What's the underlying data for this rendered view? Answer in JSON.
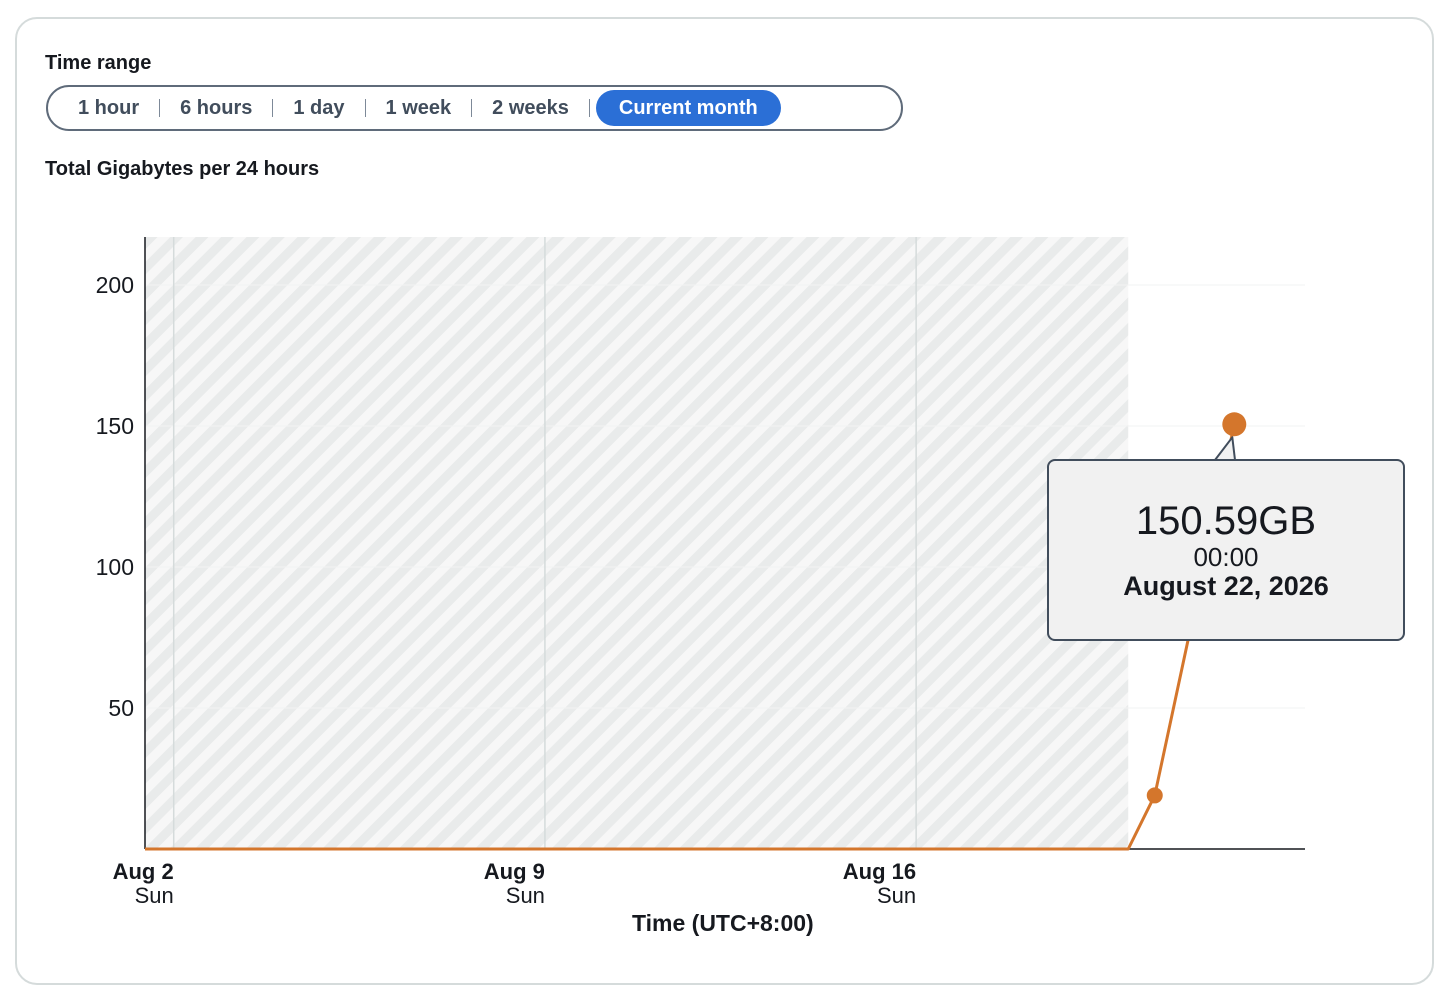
{
  "time_range": {
    "label": "Time range",
    "options": [
      "1 hour",
      "6 hours",
      "1 day",
      "1 week",
      "2 weeks",
      "Current month"
    ],
    "selected": "Current month"
  },
  "chart_title": "Total Gigabytes per 24 hours",
  "tooltip": {
    "value": "150.59GB",
    "time": "00:00",
    "date": "August 22, 2026"
  },
  "colors": {
    "series": "#d4762c",
    "selected_segment": "#2b6fd6",
    "hatch": "#e9ebeb"
  },
  "chart_data": {
    "type": "line",
    "title": "Total Gigabytes per 24 hours",
    "xlabel": "Time (UTC+8:00)",
    "ylabel": "",
    "ylim": [
      0,
      217
    ],
    "yticks": [
      50,
      100,
      150,
      200
    ],
    "xticks": [
      {
        "date": "2026-08-02",
        "label": "Aug 2",
        "sublabel": "Sun"
      },
      {
        "date": "2026-08-09",
        "label": "Aug 9",
        "sublabel": "Sun"
      },
      {
        "date": "2026-08-16",
        "label": "Aug 16",
        "sublabel": "Sun"
      }
    ],
    "xlim": [
      "2026-08-01T11:00",
      "2026-08-23T08:00"
    ],
    "no_data_region": [
      "2026-08-01T11:00",
      "2026-08-20T00:00"
    ],
    "grid": "vertical",
    "series": [
      {
        "points": [
          {
            "x": "2026-08-01T11:00",
            "y": 0
          },
          {
            "x": "2026-08-20T00:00",
            "y": 0
          },
          {
            "x": "2026-08-20T12:00",
            "y": 19
          },
          {
            "x": "2026-08-22T00:00",
            "y": 150.59
          }
        ]
      }
    ],
    "highlighted_point": {
      "x": "2026-08-22T00:00",
      "y": 150.59
    }
  }
}
